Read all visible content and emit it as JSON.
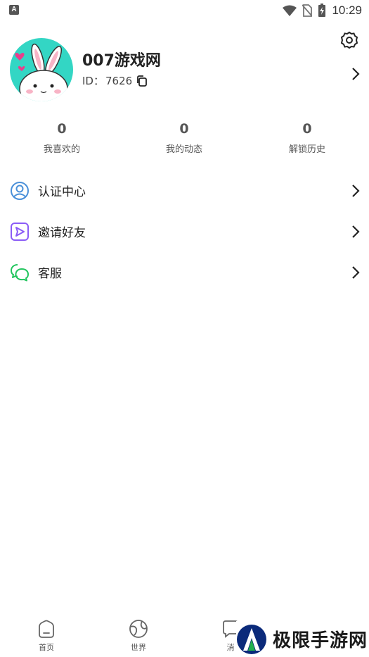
{
  "status_bar": {
    "time": "10:29",
    "left_icon_letter": "A"
  },
  "profile": {
    "username": "007游戏网",
    "id_label": "ID：",
    "id_value": "7626"
  },
  "stats": [
    {
      "value": "0",
      "label": "我喜欢的"
    },
    {
      "value": "0",
      "label": "我的动态"
    },
    {
      "value": "0",
      "label": "解锁历史"
    }
  ],
  "menu": [
    {
      "label": "认证中心",
      "icon": "user-circle-icon",
      "color": "#4a90d9"
    },
    {
      "label": "邀请好友",
      "icon": "send-box-icon",
      "color": "#8b5cf6"
    },
    {
      "label": "客服",
      "icon": "chat-bubbles-icon",
      "color": "#22c55e"
    }
  ],
  "tabs": [
    {
      "label": "首页",
      "icon": "home-icon"
    },
    {
      "label": "世界",
      "icon": "globe-icon"
    },
    {
      "label": "消",
      "icon": "message-icon"
    }
  ],
  "watermark": {
    "text": "极限手游网"
  },
  "colors": {
    "avatar_bg": "#33d6c4",
    "accent_blue": "#4a90d9",
    "accent_purple": "#8b5cf6",
    "accent_green": "#22c55e"
  }
}
